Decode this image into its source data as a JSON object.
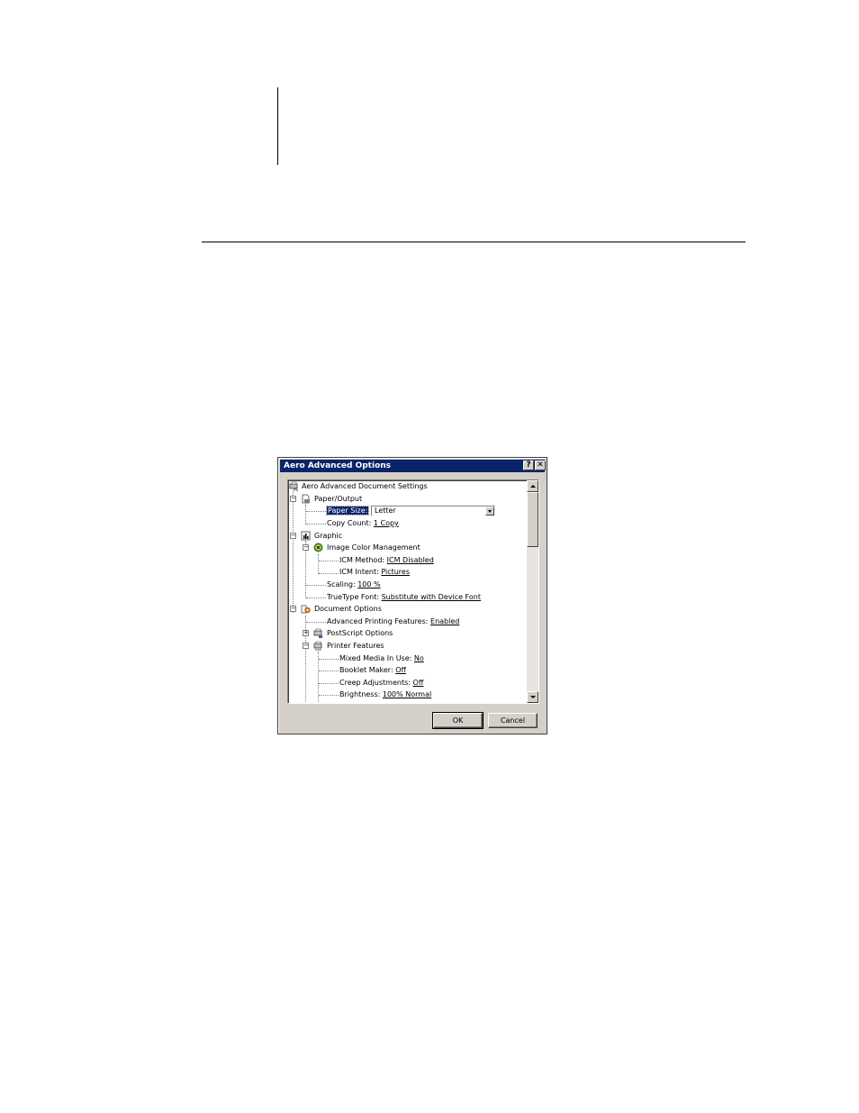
{
  "dialog": {
    "title": "Aero Advanced Options",
    "help_glyph": "?",
    "close_glyph": "✕",
    "ok_label": "OK",
    "cancel_label": "Cancel"
  },
  "tree": {
    "root": "Aero Advanced Document Settings",
    "paper_output": {
      "label": "Paper/Output",
      "paper_size_label": "Paper Size:",
      "paper_size_value": "Letter",
      "copy_count_label": "Copy Count:",
      "copy_count_value": "1 Copy"
    },
    "graphic": {
      "label": "Graphic",
      "icm_label": "Image Color Management",
      "icm_method_label": "ICM Method:",
      "icm_method_value": "ICM Disabled",
      "icm_intent_label": "ICM Intent:",
      "icm_intent_value": "Pictures",
      "scaling_label": "Scaling:",
      "scaling_value": "100 %",
      "truetype_label": "TrueType Font:",
      "truetype_value": "Substitute with Device Font"
    },
    "document_options": {
      "label": "Document Options",
      "advanced_label": "Advanced Printing Features:",
      "advanced_value": "Enabled",
      "postscript_label": "PostScript Options",
      "printer_features_label": "Printer Features",
      "mixed_media_label": "Mixed Media In Use:",
      "mixed_media_value": "No",
      "booklet_label": "Booklet Maker:",
      "booklet_value": "Off",
      "creep_label": "Creep Adjustments:",
      "creep_value": "Off",
      "brightness_label": "Brightness:",
      "brightness_value": "100% Normal"
    },
    "expander_minus": "−",
    "expander_plus": "+"
  }
}
